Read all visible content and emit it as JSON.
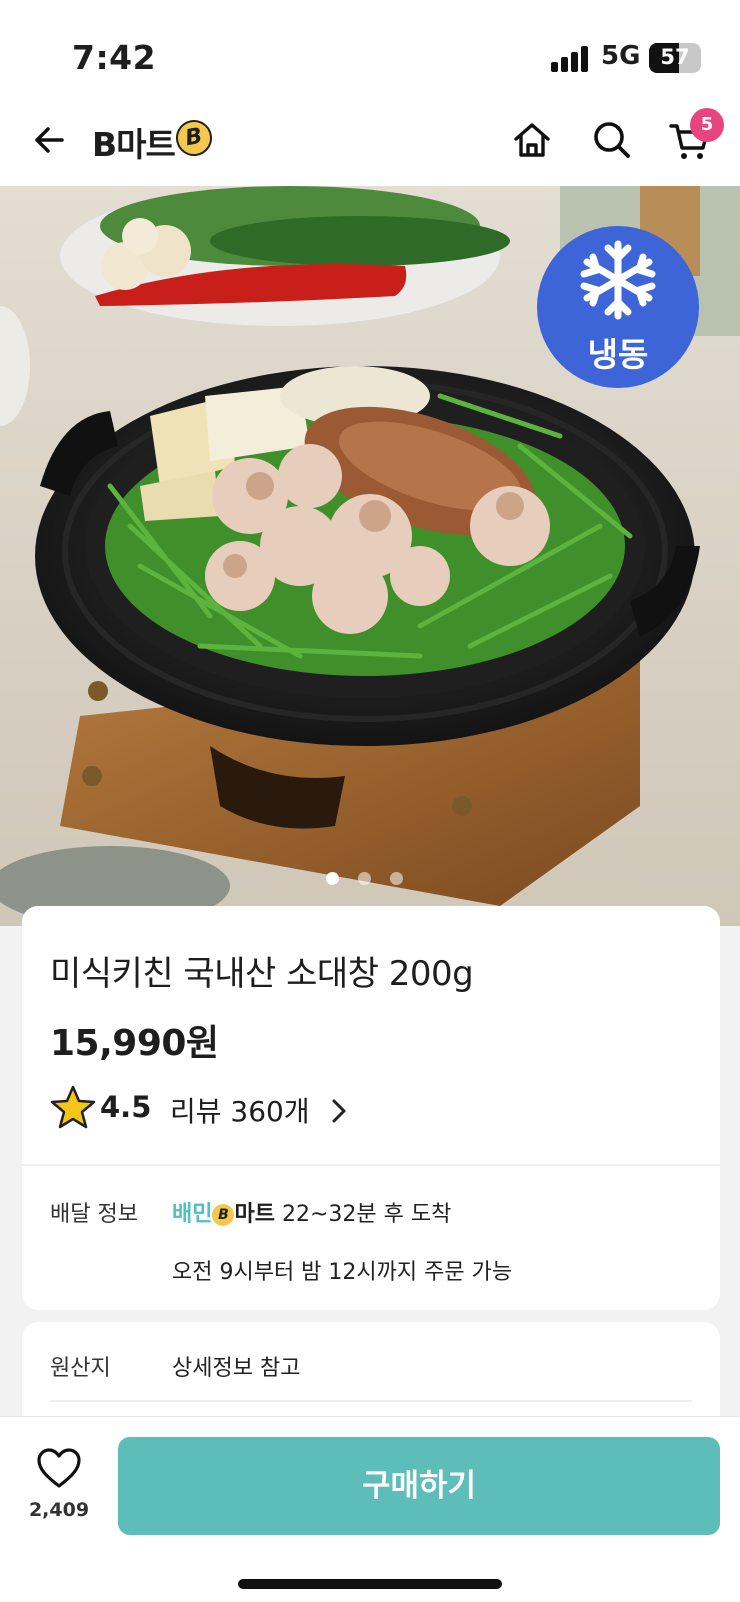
{
  "status_bar": {
    "time": "7:42",
    "network": "5G",
    "battery": "57"
  },
  "header": {
    "logo_text": "B마트",
    "logo_badge": "B",
    "cart_count": "5"
  },
  "hero": {
    "frozen_badge": "냉동",
    "carousel_pages": 3,
    "carousel_active": 1
  },
  "product": {
    "name": "미식키친 국내산 소대창 200g",
    "price": "15,990원",
    "rating": "4.5",
    "review_text": "리뷰 360개"
  },
  "delivery": {
    "label": "배달 정보",
    "brand_part1": "배민",
    "brand_icon": "B",
    "brand_part2": "마트",
    "eta": "22~32분 후 도착",
    "hours": "오전 9시부터 밤 12시까지 주문 가능"
  },
  "origin": {
    "label": "원산지",
    "value": "상세정보 참고"
  },
  "bottom_bar": {
    "like_count": "2,409",
    "buy_label": "구매하기"
  },
  "colors": {
    "accent": "#5dbdb8",
    "cart_badge": "#e8457f",
    "frozen_badge": "#3d65d8",
    "brand_mint": "#4fc1be"
  }
}
